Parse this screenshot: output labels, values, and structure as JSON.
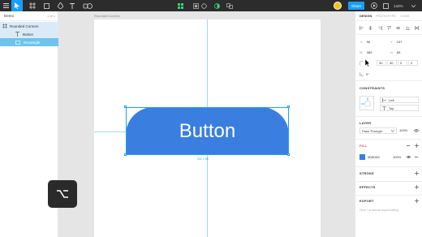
{
  "toolbar": {
    "share_label": "Share",
    "zoom_label": "142%"
  },
  "left_panel": {
    "file_name": "Demo",
    "page_indicator": "1 of 1",
    "layers": [
      {
        "label": "Rounded Corners"
      },
      {
        "label": "Button"
      },
      {
        "label": "Rectangle"
      }
    ]
  },
  "canvas": {
    "frame_label": "Rounded Corners",
    "button_text": "Button",
    "size_label": "201 × 59"
  },
  "right_panel": {
    "tabs": [
      "DESIGN",
      "PROTOTYPE",
      "CODE"
    ],
    "x_label": "X",
    "x_value": "96",
    "y_label": "Y",
    "y_value": "157",
    "w_label": "W",
    "w_value": "389",
    "h_label": "H",
    "h_value": "85",
    "radius_values": [
      "30",
      "30",
      "0",
      "0"
    ],
    "rotation_value": "0°",
    "constraints_title": "CONSTRAINTS",
    "constraint_h": "Left",
    "constraint_v": "Top",
    "layer_title": "LAYER",
    "blend_mode": "Pass Through",
    "opacity": "100%",
    "fill_title": "FILL",
    "fill_hex": "4D80D0",
    "fill_opacity": "100%",
    "stroke_title": "STROKE",
    "effects_title": "EFFECTS",
    "export_title": "EXPORT",
    "export_hint": "Click + to add an export setting"
  },
  "colors": {
    "accent": "#18a0fb",
    "button_fill": "#3a7fe0",
    "toolbar_bg": "#2c2c2c"
  }
}
